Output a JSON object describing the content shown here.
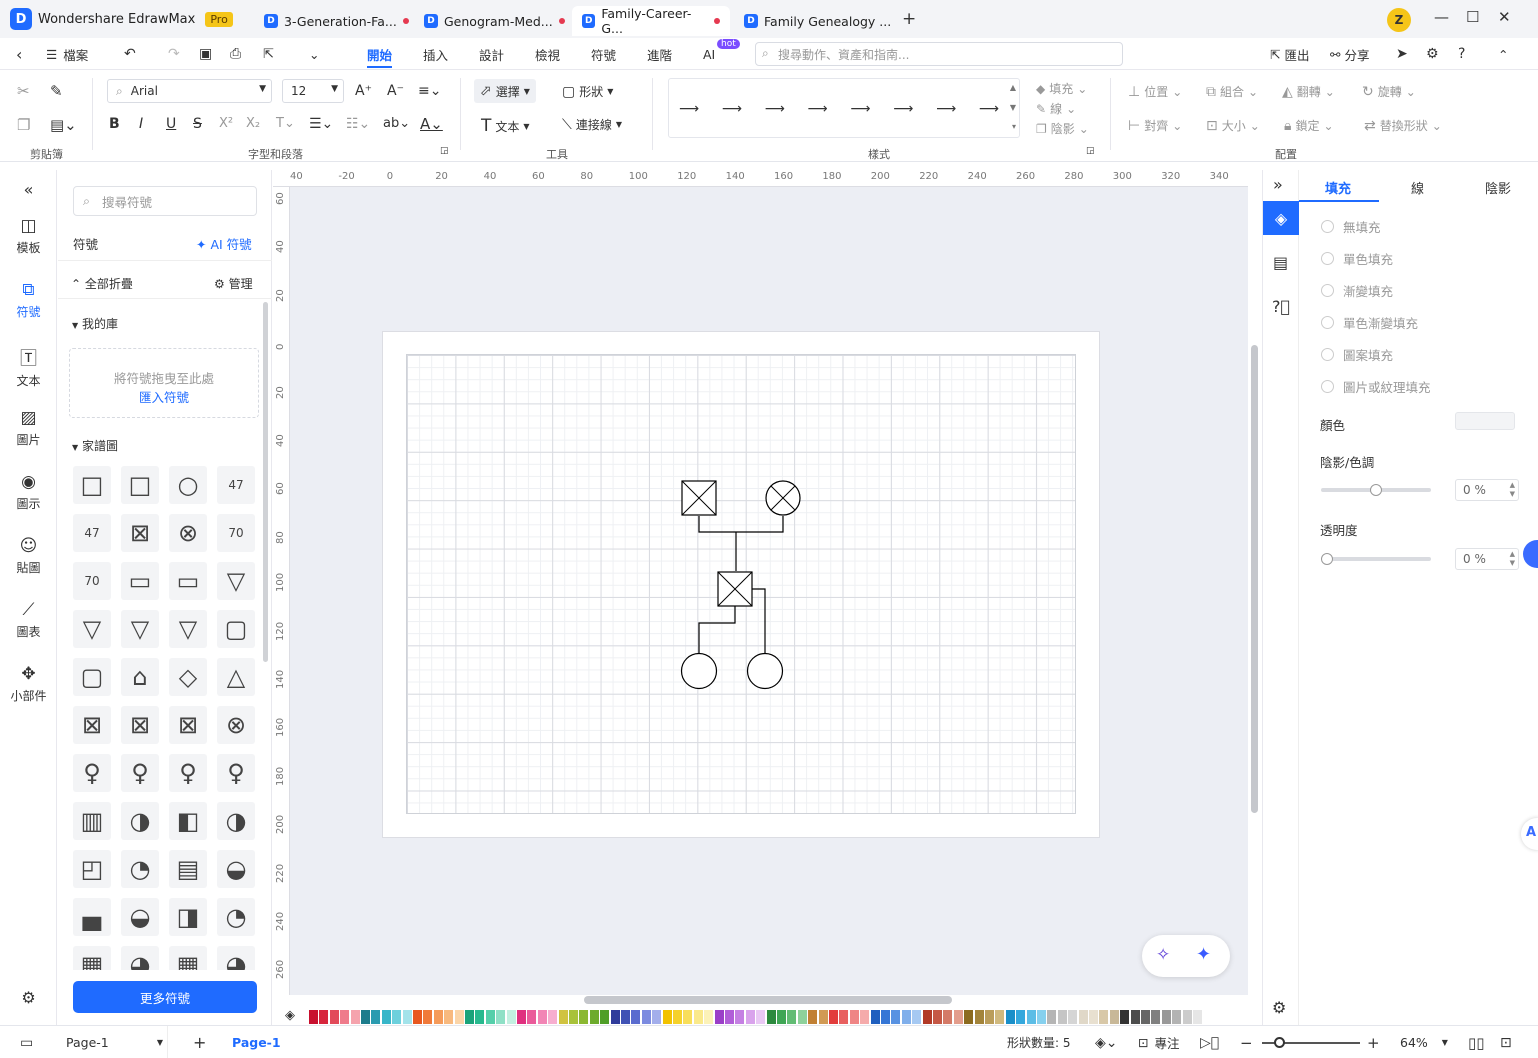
{
  "titlebar": {
    "app_name": "Wondershare EdrawMax",
    "badge": "Pro",
    "tabs": [
      {
        "label": "3-Generation-Fa...",
        "modified": true
      },
      {
        "label": "Genogram-Med...",
        "modified": true
      },
      {
        "label": "Family-Career-G...",
        "modified": true,
        "active": true
      },
      {
        "label": "Family Genealogy ...",
        "modified": false
      }
    ],
    "new_tab": "+",
    "user_initial": "Z"
  },
  "menubar": {
    "file": "檔案",
    "items": [
      "開始",
      "插入",
      "設計",
      "檢視",
      "符號",
      "進階",
      "AI"
    ],
    "active": "開始",
    "ai_badge": "hot",
    "search_placeholder": "搜尋動作、資產和指南...",
    "export": "匯出",
    "share": "分享"
  },
  "ribbon": {
    "font": "Arial",
    "size": "12",
    "select": "選擇",
    "shape": "形狀",
    "text": "文本",
    "connector": "連接線",
    "fill": "填充",
    "line": "線",
    "shadow": "陰影",
    "position": "位置",
    "group": "組合",
    "flip": "翻轉",
    "rotate": "旋轉",
    "align": "對齊",
    "size_btn": "大小",
    "lock": "鎖定",
    "replace": "替換形狀",
    "groups": {
      "clipboard": "剪貼簿",
      "font_para": "字型和段落",
      "tools": "工具",
      "style": "樣式",
      "arrange": "配置"
    }
  },
  "rail": [
    {
      "label": "模板",
      "icon": "template-icon"
    },
    {
      "label": "符號",
      "icon": "symbol-icon",
      "active": true
    },
    {
      "label": "文本",
      "icon": "text-icon"
    },
    {
      "label": "圖片",
      "icon": "image-icon"
    },
    {
      "label": "圖示",
      "icon": "icons-icon"
    },
    {
      "label": "貼圖",
      "icon": "sticker-icon"
    },
    {
      "label": "圖表",
      "icon": "chart-icon"
    },
    {
      "label": "小部件",
      "icon": "widget-icon"
    }
  ],
  "symbols": {
    "search_placeholder": "搜尋符號",
    "header": "符號",
    "ai_symbol": "AI 符號",
    "collapse_all": "全部折疊",
    "manage": "管理",
    "my_library": "我的庫",
    "drop_hint": "將符號拖曳至此處",
    "import_link": "匯入符號",
    "genogram": "家譜圖",
    "more_button": "更多符號"
  },
  "ruler": {
    "h": [
      "40",
      "-20",
      "0",
      "20",
      "40",
      "60",
      "80",
      "100",
      "120",
      "140",
      "160",
      "180",
      "200",
      "220",
      "240",
      "260",
      "280",
      "300",
      "320",
      "340"
    ],
    "v": [
      "60",
      "40",
      "20",
      "0",
      "20",
      "40",
      "60",
      "80",
      "100",
      "120",
      "140",
      "160",
      "180",
      "200",
      "220",
      "240",
      "260"
    ]
  },
  "rightpanel": {
    "tabs": [
      "填充",
      "線",
      "陰影"
    ],
    "active_tab": "填充",
    "fill_options": [
      "無填充",
      "單色填充",
      "漸變填充",
      "單色漸變填充",
      "圖案填充",
      "圖片或紋理填充"
    ],
    "color_label": "顏色",
    "shade_label": "陰影/色調",
    "shade_value": "0 %",
    "shade_fraction": 0.5,
    "transparency_label": "透明度",
    "transparency_value": "0 %",
    "transparency_fraction": 0.0
  },
  "status": {
    "page_select": "Page-1",
    "add": "+",
    "page_tab": "Page-1",
    "shape_count": "形狀數量: 5",
    "focus": "專注",
    "zoom": "64%"
  }
}
